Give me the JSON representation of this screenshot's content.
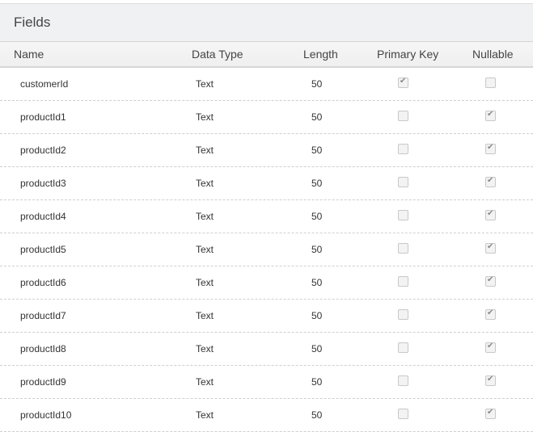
{
  "panel": {
    "title": "Fields"
  },
  "table": {
    "columns": [
      "Name",
      "Data Type",
      "Length",
      "Primary Key",
      "Nullable"
    ],
    "rows": [
      {
        "name": "customerId",
        "type": "Text",
        "length": "50",
        "primary_key": true,
        "nullable": false
      },
      {
        "name": "productId1",
        "type": "Text",
        "length": "50",
        "primary_key": false,
        "nullable": true
      },
      {
        "name": "productId2",
        "type": "Text",
        "length": "50",
        "primary_key": false,
        "nullable": true
      },
      {
        "name": "productId3",
        "type": "Text",
        "length": "50",
        "primary_key": false,
        "nullable": true
      },
      {
        "name": "productId4",
        "type": "Text",
        "length": "50",
        "primary_key": false,
        "nullable": true
      },
      {
        "name": "productId5",
        "type": "Text",
        "length": "50",
        "primary_key": false,
        "nullable": true
      },
      {
        "name": "productId6",
        "type": "Text",
        "length": "50",
        "primary_key": false,
        "nullable": true
      },
      {
        "name": "productId7",
        "type": "Text",
        "length": "50",
        "primary_key": false,
        "nullable": true
      },
      {
        "name": "productId8",
        "type": "Text",
        "length": "50",
        "primary_key": false,
        "nullable": true
      },
      {
        "name": "productId9",
        "type": "Text",
        "length": "50",
        "primary_key": false,
        "nullable": true
      },
      {
        "name": "productId10",
        "type": "Text",
        "length": "50",
        "primary_key": false,
        "nullable": true
      }
    ]
  }
}
